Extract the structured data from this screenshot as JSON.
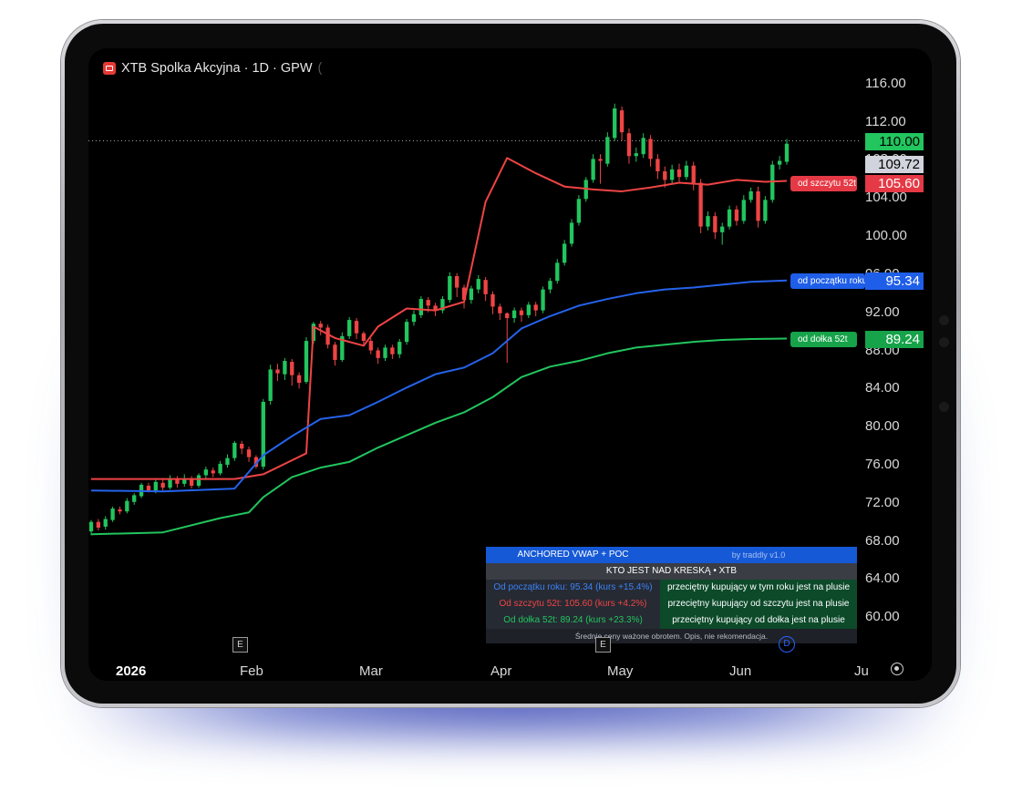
{
  "header": {
    "title": "XTB Spolka Akcyjna · 1D · GPW"
  },
  "chart_data": {
    "type": "candlestick",
    "symbol": "XTB Spolka Akcyjna",
    "interval": "1D",
    "exchange": "GPW",
    "y_ticks": [
      "116.00",
      "112.00",
      "108.00",
      "104.00",
      "100.00",
      "96.00",
      "92.00",
      "88.00",
      "84.00",
      "80.00",
      "76.00",
      "72.00",
      "68.00",
      "64.00",
      "60.00"
    ],
    "ylim": [
      58.3,
      117.8
    ],
    "x_ticks": [
      "2026",
      "Feb",
      "Mar",
      "Apr",
      "May",
      "Jun",
      "Ju"
    ],
    "price_tags": [
      {
        "value": "110.00",
        "color": "#22c55e",
        "text_color": "#000000"
      },
      {
        "value": "109.72",
        "color": "#d1d4dc",
        "text_color": "#000000"
      },
      {
        "value": "105.60",
        "color": "#e53945",
        "text_color": "#ffffff"
      },
      {
        "value": "95.34",
        "color": "#1e5ee8",
        "text_color": "#ffffff"
      },
      {
        "value": "89.24",
        "color": "#16a34a",
        "text_color": "#ffffff"
      }
    ],
    "line_labels": [
      {
        "text": "od szczytu 52t",
        "color": "#e53945"
      },
      {
        "text": "od początku roku",
        "color": "#1e5ee8"
      },
      {
        "text": "od dołka 52t",
        "color": "#16a34a"
      }
    ],
    "series": [
      {
        "name": "od szczytu 52t",
        "color": "#ef4444",
        "points": [
          [
            0,
            74.5
          ],
          [
            10,
            74.5
          ],
          [
            20,
            74.5
          ],
          [
            24,
            75
          ],
          [
            30,
            77.2
          ],
          [
            31,
            90.5
          ],
          [
            34,
            89.3
          ],
          [
            38,
            88.5
          ],
          [
            40,
            90.5
          ],
          [
            44,
            92.4
          ],
          [
            48,
            92.2
          ],
          [
            52,
            93.1
          ],
          [
            55,
            103.6
          ],
          [
            58,
            108.2
          ],
          [
            62,
            106.6
          ],
          [
            66,
            105.2
          ],
          [
            70,
            104.9
          ],
          [
            74,
            104.7
          ],
          [
            78,
            105.1
          ],
          [
            82,
            105.6
          ],
          [
            86,
            105.4
          ],
          [
            90,
            105.9
          ],
          [
            94,
            105.7
          ],
          [
            97,
            105.8
          ]
        ]
      },
      {
        "name": "od początku roku",
        "color": "#2563eb",
        "points": [
          [
            0,
            73.3
          ],
          [
            10,
            73.2
          ],
          [
            20,
            73.5
          ],
          [
            24,
            77
          ],
          [
            28,
            79
          ],
          [
            32,
            80.8
          ],
          [
            36,
            81.2
          ],
          [
            40,
            82.6
          ],
          [
            44,
            84.1
          ],
          [
            48,
            85.5
          ],
          [
            52,
            86.2
          ],
          [
            56,
            87.7
          ],
          [
            60,
            90.3
          ],
          [
            64,
            91.6
          ],
          [
            68,
            92.7
          ],
          [
            72,
            93.4
          ],
          [
            76,
            94
          ],
          [
            80,
            94.4
          ],
          [
            84,
            94.6
          ],
          [
            88,
            94.9
          ],
          [
            92,
            95.2
          ],
          [
            97,
            95.34
          ]
        ]
      },
      {
        "name": "od dołka 52t",
        "color": "#22c55e",
        "points": [
          [
            0,
            68.7
          ],
          [
            10,
            68.9
          ],
          [
            18,
            70.4
          ],
          [
            22,
            71
          ],
          [
            24,
            72.6
          ],
          [
            28,
            74.7
          ],
          [
            32,
            75.7
          ],
          [
            36,
            76.3
          ],
          [
            40,
            77.8
          ],
          [
            44,
            79.1
          ],
          [
            48,
            80.4
          ],
          [
            52,
            81.5
          ],
          [
            56,
            83.1
          ],
          [
            60,
            85.2
          ],
          [
            64,
            86.3
          ],
          [
            68,
            86.9
          ],
          [
            72,
            87.7
          ],
          [
            76,
            88.3
          ],
          [
            80,
            88.6
          ],
          [
            84,
            88.9
          ],
          [
            88,
            89.1
          ],
          [
            92,
            89.2
          ],
          [
            97,
            89.24
          ]
        ]
      }
    ],
    "candles": [
      [
        0,
        69.0,
        70.0,
        68.6,
        70.2
      ],
      [
        1,
        70.0,
        69.4,
        69.1,
        70.3
      ],
      [
        2,
        69.5,
        70.3,
        69.2,
        70.6
      ],
      [
        3,
        70.2,
        71.4,
        70.0,
        71.6
      ],
      [
        4,
        71.3,
        71.1,
        70.8,
        71.6
      ],
      [
        5,
        71.1,
        72.2,
        70.9,
        72.5
      ],
      [
        6,
        72.1,
        72.8,
        71.8,
        73.0
      ],
      [
        7,
        72.7,
        73.9,
        72.5,
        74.1
      ],
      [
        8,
        73.8,
        73.3,
        73.1,
        74.1
      ],
      [
        9,
        73.3,
        74.2,
        73.0,
        74.4
      ],
      [
        10,
        74.1,
        73.6,
        73.3,
        74.6
      ],
      [
        11,
        73.6,
        74.6,
        73.4,
        74.9
      ],
      [
        12,
        74.5,
        74.0,
        73.6,
        74.8
      ],
      [
        13,
        74.0,
        74.5,
        73.7,
        75.0
      ],
      [
        14,
        74.5,
        73.8,
        73.5,
        74.8
      ],
      [
        15,
        73.8,
        74.9,
        73.6,
        75.1
      ],
      [
        16,
        74.9,
        75.5,
        74.6,
        75.8
      ],
      [
        17,
        75.4,
        75.1,
        74.7,
        75.7
      ],
      [
        18,
        75.1,
        76.1,
        74.9,
        76.4
      ],
      [
        19,
        76.0,
        76.7,
        75.7,
        77.1
      ],
      [
        20,
        76.7,
        78.3,
        76.4,
        78.5
      ],
      [
        21,
        78.2,
        77.7,
        77.1,
        78.5
      ],
      [
        22,
        77.6,
        76.8,
        76.3,
        77.9
      ],
      [
        23,
        76.8,
        75.8,
        75.6,
        77.0
      ],
      [
        24,
        75.8,
        82.6,
        75.5,
        82.9
      ],
      [
        25,
        82.7,
        86.0,
        82.3,
        86.5
      ],
      [
        26,
        86.0,
        85.6,
        84.8,
        86.6
      ],
      [
        27,
        85.5,
        86.9,
        84.9,
        87.2
      ],
      [
        28,
        86.8,
        85.4,
        84.3,
        87.1
      ],
      [
        29,
        85.4,
        84.6,
        84.0,
        85.7
      ],
      [
        30,
        84.7,
        89.0,
        84.5,
        89.4
      ],
      [
        31,
        89.0,
        90.8,
        88.7,
        91.0
      ],
      [
        32,
        90.8,
        90.4,
        89.6,
        91.1
      ],
      [
        33,
        90.4,
        88.6,
        88.2,
        90.7
      ],
      [
        34,
        88.6,
        87.0,
        86.4,
        88.9
      ],
      [
        35,
        87.0,
        89.5,
        86.8,
        89.9
      ],
      [
        36,
        89.5,
        91.2,
        89.2,
        91.5
      ],
      [
        37,
        91.1,
        89.8,
        89.2,
        91.4
      ],
      [
        38,
        89.8,
        89.0,
        88.4,
        90.0
      ],
      [
        39,
        89.0,
        88.0,
        87.6,
        89.3
      ],
      [
        40,
        88.0,
        87.2,
        86.6,
        88.3
      ],
      [
        41,
        87.2,
        88.3,
        86.9,
        88.6
      ],
      [
        42,
        88.3,
        87.6,
        87.1,
        88.6
      ],
      [
        43,
        87.6,
        88.9,
        87.2,
        89.2
      ],
      [
        44,
        88.9,
        91.0,
        88.6,
        91.3
      ],
      [
        45,
        91.0,
        91.8,
        90.6,
        92.2
      ],
      [
        46,
        91.7,
        93.4,
        91.4,
        93.7
      ],
      [
        47,
        93.3,
        92.7,
        92.0,
        93.6
      ],
      [
        48,
        92.7,
        92.2,
        91.6,
        93.0
      ],
      [
        49,
        92.2,
        93.4,
        91.9,
        93.7
      ],
      [
        50,
        93.3,
        95.8,
        93.0,
        96.2
      ],
      [
        51,
        95.8,
        94.6,
        93.6,
        96.1
      ],
      [
        52,
        94.6,
        93.3,
        92.4,
        94.9
      ],
      [
        53,
        93.3,
        94.5,
        92.9,
        94.8
      ],
      [
        54,
        94.4,
        95.5,
        94.0,
        95.9
      ],
      [
        55,
        95.4,
        93.9,
        93.2,
        95.7
      ],
      [
        56,
        93.9,
        92.6,
        91.8,
        94.2
      ],
      [
        57,
        92.6,
        91.9,
        91.2,
        92.9
      ],
      [
        58,
        91.9,
        91.4,
        86.7,
        92.0
      ],
      [
        59,
        91.4,
        92.2,
        90.9,
        92.5
      ],
      [
        60,
        92.2,
        91.7,
        91.0,
        92.5
      ],
      [
        61,
        91.7,
        92.8,
        91.4,
        93.1
      ],
      [
        62,
        92.8,
        92.2,
        91.6,
        93.1
      ],
      [
        63,
        92.2,
        94.4,
        91.9,
        94.7
      ],
      [
        64,
        94.4,
        95.3,
        94.0,
        95.6
      ],
      [
        65,
        95.3,
        97.2,
        95.0,
        97.6
      ],
      [
        66,
        97.2,
        99.2,
        96.9,
        99.6
      ],
      [
        67,
        99.2,
        101.4,
        98.9,
        101.8
      ],
      [
        68,
        101.4,
        103.9,
        101.1,
        104.3
      ],
      [
        69,
        103.9,
        105.9,
        103.6,
        106.2
      ],
      [
        70,
        105.9,
        108.1,
        105.6,
        108.6
      ],
      [
        71,
        108.1,
        107.9,
        105.5,
        108.6
      ],
      [
        72,
        107.6,
        110.4,
        107.3,
        110.9
      ],
      [
        73,
        110.3,
        113.4,
        110.0,
        113.9
      ],
      [
        74,
        113.2,
        110.9,
        110.0,
        113.6
      ],
      [
        75,
        110.8,
        108.4,
        107.6,
        111.3
      ],
      [
        76,
        108.4,
        108.7,
        107.8,
        109.3
      ],
      [
        77,
        108.6,
        110.3,
        108.2,
        110.8
      ],
      [
        78,
        110.2,
        108.1,
        107.3,
        110.6
      ],
      [
        79,
        108.1,
        106.8,
        106.0,
        108.6
      ],
      [
        80,
        106.8,
        105.9,
        105.1,
        107.3
      ],
      [
        81,
        105.9,
        107.0,
        105.4,
        107.5
      ],
      [
        82,
        107.0,
        106.2,
        105.6,
        107.6
      ],
      [
        83,
        106.2,
        107.4,
        105.9,
        107.9
      ],
      [
        84,
        107.4,
        105.6,
        104.8,
        107.8
      ],
      [
        85,
        105.6,
        101.0,
        100.3,
        106.0
      ],
      [
        86,
        101.0,
        102.1,
        100.6,
        102.6
      ],
      [
        87,
        102.1,
        100.4,
        99.7,
        102.5
      ],
      [
        88,
        100.4,
        101.0,
        99.1,
        101.4
      ],
      [
        89,
        101.0,
        102.8,
        100.7,
        103.2
      ],
      [
        90,
        102.8,
        101.6,
        101.1,
        103.2
      ],
      [
        91,
        101.6,
        103.8,
        101.3,
        104.3
      ],
      [
        92,
        103.8,
        104.7,
        103.5,
        105.1
      ],
      [
        93,
        104.7,
        101.6,
        100.9,
        105.2
      ],
      [
        94,
        101.6,
        103.8,
        101.3,
        104.2
      ],
      [
        95,
        103.8,
        107.5,
        103.5,
        107.9
      ],
      [
        96,
        107.5,
        107.9,
        107.0,
        108.4
      ],
      [
        97,
        107.8,
        109.7,
        107.5,
        110.2
      ]
    ],
    "table": {
      "header_left": "ANCHORED VWAP + POC",
      "header_right": "by traddly  v1.0",
      "subheader": "KTO JEST NAD KRESKĄ  •  XTB",
      "rows": [
        {
          "left": "Od początku roku: 95.34  (kurs +15.4%)",
          "right": "przeciętny kupujący w tym roku jest na plusie",
          "left_color": "#3b82f6"
        },
        {
          "left": "Od szczytu 52t: 105.60  (kurs +4.2%)",
          "right": "przeciętny kupujący od szczytu jest na plusie",
          "left_color": "#ef4444"
        },
        {
          "left": "Od dołka 52t: 89.24  (kurs +23.3%)",
          "right": "przeciętny kupujący od dołka jest na plusie",
          "left_color": "#22c55e"
        }
      ],
      "footer": "Średnie ceny ważone obrotem. Opis, nie rekomendacja."
    },
    "event_markers": [
      "E",
      "E",
      "D"
    ]
  }
}
